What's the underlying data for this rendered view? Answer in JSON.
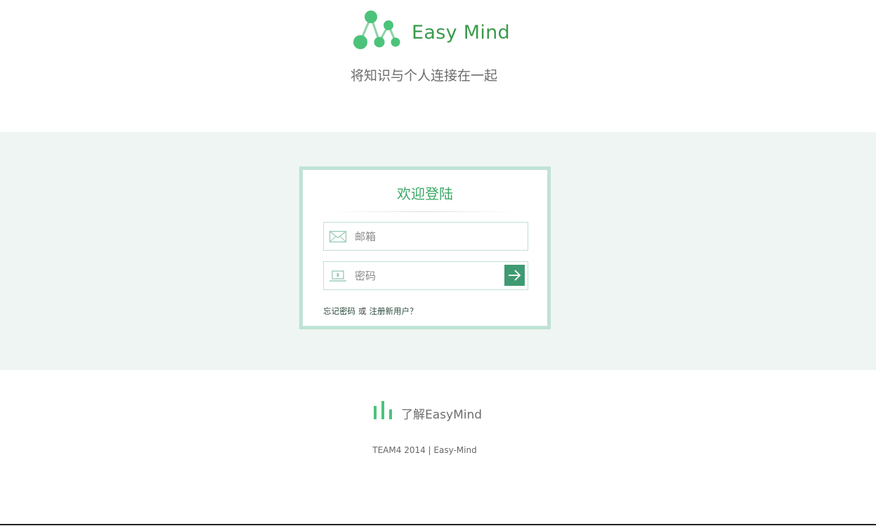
{
  "header": {
    "brand_name": "Easy Mind",
    "tagline": "将知识与个人连接在一起",
    "logo_icon": "network-nodes-logo",
    "brand_color": "#3a9a4a"
  },
  "login": {
    "title": "欢迎登陆",
    "email_placeholder": "邮箱",
    "email_value": "",
    "email_icon": "envelope-icon",
    "password_placeholder": "密码",
    "password_value": "",
    "password_icon": "laptop-icon",
    "submit_icon": "arrow-right-icon",
    "forgot_label": "忘记密码",
    "or_label": "或",
    "register_label": "注册新用户？",
    "accent_color": "#3e9a72",
    "border_color": "#bfe3d4",
    "band_color": "#eff5f2"
  },
  "footer": {
    "about_label": "了解EasyMind",
    "about_icon": "bar-chart-icon",
    "copyright": "TEAM4 2014 | Easy-Mind"
  }
}
